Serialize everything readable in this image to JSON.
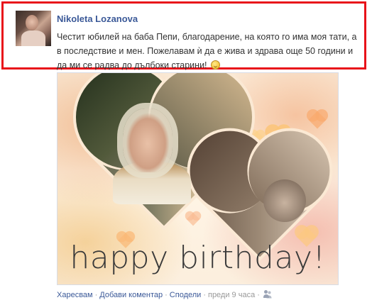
{
  "post": {
    "author": "Nikoleta Lozanova",
    "text": "Честит юбилей на баба Пепи, благодарение, на която го има моя тати, а в последствие и мен. Пожелавам ѝ да е жива и здрава още 50 години и да ми се радва до дълбоки старини!",
    "emoji_icon": "smiley-icon",
    "highlight_color": "#e8121a"
  },
  "photo": {
    "caption_text": "happy birthday!"
  },
  "actions": {
    "like": "Харесвам",
    "comment": "Добави коментар",
    "share": "Сподели",
    "time": "преди 9 часа",
    "privacy_icon": "friends-icon"
  }
}
